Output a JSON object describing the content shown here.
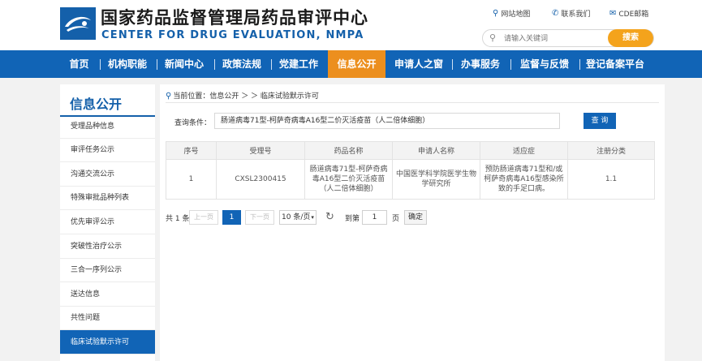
{
  "header": {
    "title_cn": "国家药品监督管理局药品审评中心",
    "title_en": "CENTER FOR DRUG EVALUATION, NMPA",
    "links": {
      "sitemap": "网站地图",
      "contact": "联系我们",
      "mail": "CDE邮箱"
    },
    "search_placeholder": "请输入关键词",
    "search_button": "搜索"
  },
  "nav": [
    "首页",
    "机构职能",
    "新闻中心",
    "政策法规",
    "党建工作",
    "信息公开",
    "申请人之窗",
    "办事服务",
    "监督与反馈",
    "登记备案平台"
  ],
  "sidebar": {
    "title": "信息公开",
    "items": [
      "受理品种信息",
      "审评任务公示",
      "沟通交流公示",
      "特殊审批品种列表",
      "优先审评公示",
      "突破性治疗公示",
      "三合一序列公示",
      "送达信息",
      "共性问题",
      "临床试验默示许可"
    ]
  },
  "breadcrumb": "当前位置：信息公开 ＞ ＞ 临床试验默示许可",
  "query": {
    "label": "查询条件：",
    "value": "肠道病毒71型-柯萨奇病毒A16型二价灭活疫苗（人二倍体细胞）",
    "button": "查 询"
  },
  "table": {
    "headers": [
      "序号",
      "受理号",
      "药品名称",
      "申请人名称",
      "适应症",
      "注册分类"
    ],
    "rows": [
      {
        "no": "1",
        "accept_no": "CXSL2300415",
        "drug_name": "肠道病毒71型-柯萨奇病毒A16型二价灭活疫苗（人二倍体细胞）",
        "applicant": "中国医学科学院医学生物学研究所",
        "indication": "预防肠道病毒71型和/或柯萨奇病毒A16型感染所致的手足口病。",
        "category": "1.1"
      }
    ]
  },
  "pagination": {
    "total": "共 1 条",
    "prev": "上一页",
    "current": "1",
    "next": "下一页",
    "per_page": "10 条/页",
    "goto_label": "到第",
    "goto_value": "1",
    "page_suffix": "页",
    "confirm": "确定"
  }
}
